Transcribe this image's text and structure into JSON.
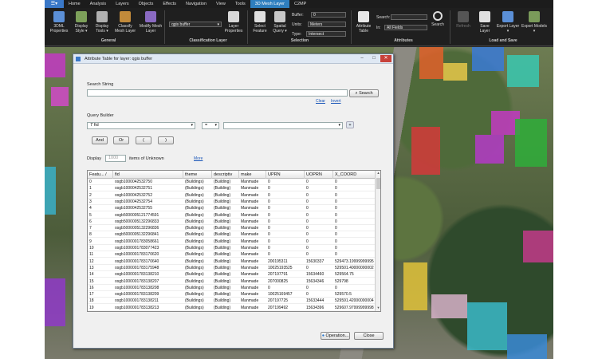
{
  "menubar": {
    "tabs": [
      "Home",
      "Analysis",
      "Layers",
      "Objects",
      "Effects",
      "Navigation",
      "View",
      "Tools",
      "3D Mesh Layer",
      "C2MP"
    ],
    "active_index": 8
  },
  "ribbon": {
    "general": {
      "group_label": "General",
      "btn_props": "3DML Properties",
      "btn_style": "Display Style ▾",
      "btn_tools": "Display Tools ▾",
      "btn_classify": "Classify Mesh Layer",
      "btn_modify": "Modify Mesh Layer"
    },
    "classification": {
      "group_label": "Classification Layer",
      "layer_value": "qgis buffer",
      "btn_layer_props": "Layer Properties"
    },
    "selection": {
      "group_label": "Selection",
      "btn_select": "Select Feature",
      "btn_spatial": "Spatial Query ▾",
      "buffer_label": "Buffer:",
      "buffer_value": "0",
      "units_label": "Units:",
      "units_value": "Meters",
      "type_label": "Type:",
      "type_value": "Intersect"
    },
    "attributes": {
      "group_label": "Attributes",
      "btn_table": "Attribute Table",
      "search_label": "Search:",
      "in_label": "In:",
      "search_value": "",
      "in_value": "All Fields",
      "btn_search": "Search"
    },
    "loadsave": {
      "group_label": "Load and Save",
      "btn_refresh": "Refresh",
      "btn_save": "Save Layer",
      "btn_export_layer": "Export Layer ▾",
      "btn_export_models": "Export Models ▾"
    }
  },
  "dialog": {
    "title": "Attribute Table for layer: qgis buffer",
    "search_string_label": "Search String",
    "search_value": "",
    "clear_link": "Clear",
    "invert_link": "Invert",
    "search_button": "Search",
    "query_builder_label": "Query Builder",
    "field_value": "fid",
    "operator_value": "=",
    "value_value": "",
    "and_button": "And",
    "or_button": "Or",
    "lparen_button": "(",
    "rparen_button": ")",
    "display_label": "Display",
    "display_value": "1000",
    "items_label": "items of Unknown",
    "more_link": "More",
    "operation_button": "Operation...",
    "close_button": "Close"
  },
  "table": {
    "columns": [
      "Featu... /",
      "fid",
      "theme",
      "descriptiv",
      "make",
      "UPRN",
      "UOPRN",
      "X_COORD"
    ],
    "rows": [
      [
        "0",
        "osgb1000042532750",
        "(Buildings)",
        "(Building)",
        "Manmade",
        "0",
        "0",
        "0"
      ],
      [
        "1",
        "osgb1000042532751",
        "(Buildings)",
        "(Building)",
        "Manmade",
        "0",
        "0",
        "0"
      ],
      [
        "2",
        "osgb1000042532752",
        "(Buildings)",
        "(Building)",
        "Manmade",
        "0",
        "0",
        "0"
      ],
      [
        "3",
        "osgb1000042532754",
        "(Buildings)",
        "(Building)",
        "Manmade",
        "0",
        "0",
        "0"
      ],
      [
        "4",
        "osgb1000042532755",
        "(Buildings)",
        "(Building)",
        "Manmade",
        "0",
        "0",
        "0"
      ],
      [
        "5",
        "osgb5000005121774591",
        "(Buildings)",
        "(Building)",
        "Manmade",
        "0",
        "0",
        "0"
      ],
      [
        "6",
        "osgb5000005132296833",
        "(Buildings)",
        "(Building)",
        "Manmade",
        "0",
        "0",
        "0"
      ],
      [
        "7",
        "osgb5000005132296836",
        "(Buildings)",
        "(Building)",
        "Manmade",
        "0",
        "0",
        "0"
      ],
      [
        "8",
        "osgb5000005132296841",
        "(Buildings)",
        "(Building)",
        "Manmade",
        "0",
        "0",
        "0"
      ],
      [
        "9",
        "osgb1000001783058661",
        "(Buildings)",
        "(Building)",
        "Manmade",
        "0",
        "0",
        "0"
      ],
      [
        "10",
        "osgb1000001783077423",
        "(Buildings)",
        "(Building)",
        "Manmade",
        "0",
        "0",
        "0"
      ],
      [
        "11",
        "osgb1000001783170620",
        "(Buildings)",
        "(Building)",
        "Manmade",
        "0",
        "0",
        "0"
      ],
      [
        "12",
        "osgb1000001783170640",
        "(Buildings)",
        "(Building)",
        "Manmade",
        "200195311",
        "15630337",
        "529473.19999999995"
      ],
      [
        "13",
        "osgb1000001783175948",
        "(Buildings)",
        "(Building)",
        "Manmade",
        "10025193525",
        "0",
        "529501.40000000002"
      ],
      [
        "14",
        "osgb1000001783138210",
        "(Buildings)",
        "(Building)",
        "Manmade",
        "207197791",
        "15634460",
        "529564.75"
      ],
      [
        "15",
        "osgb1000001783138207",
        "(Buildings)",
        "(Building)",
        "Manmade",
        "207000825",
        "15634346",
        "529798"
      ],
      [
        "16",
        "osgb1000001783138208",
        "(Buildings)",
        "(Building)",
        "Manmade",
        "0",
        "0",
        "0"
      ],
      [
        "17",
        "osgb1000001783138209",
        "(Buildings)",
        "(Building)",
        "Manmade",
        "10025169457",
        "0",
        "529570.5"
      ],
      [
        "18",
        "osgb1000001783138211",
        "(Buildings)",
        "(Building)",
        "Manmade",
        "207197725",
        "15633444",
        "529591.42000000004"
      ],
      [
        "19",
        "osgb1000001783138213",
        "(Buildings)",
        "(Building)",
        "Manmade",
        "207199492",
        "15634396",
        "529607.97999999998"
      ]
    ]
  }
}
